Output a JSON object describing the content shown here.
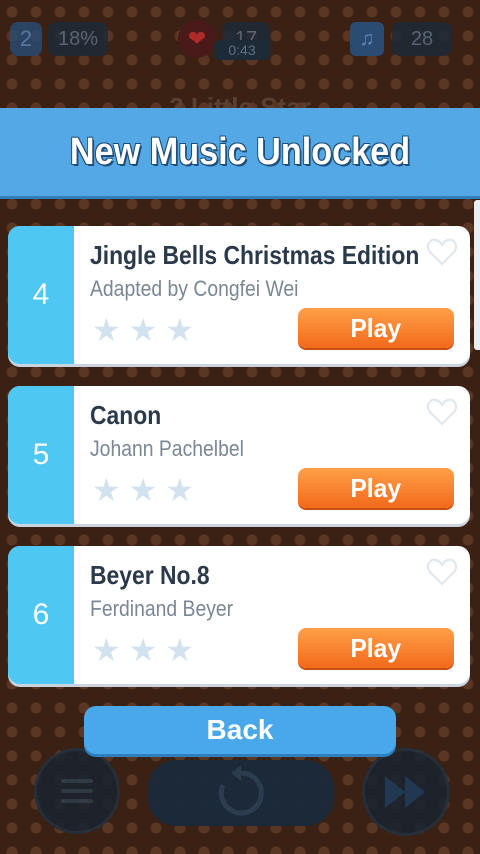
{
  "hud": {
    "level": "2",
    "percent": "18%",
    "lives": "17",
    "timer": "0:43",
    "notes": "28"
  },
  "background_title": "2 Little Star",
  "banner": {
    "title": "New Music Unlocked"
  },
  "songs": [
    {
      "number": "4",
      "title": "Jingle Bells Christmas Edition",
      "author": "Adapted by Congfei Wei",
      "play_label": "Play",
      "stars_earned": 0,
      "stars_total": 3
    },
    {
      "number": "5",
      "title": "Canon",
      "author": "Johann Pachelbel",
      "play_label": "Play",
      "stars_earned": 0,
      "stars_total": 3
    },
    {
      "number": "6",
      "title": "Beyer No.8",
      "author": "Ferdinand Beyer",
      "play_label": "Play",
      "stars_earned": 0,
      "stars_total": 3
    }
  ],
  "back_label": "Back",
  "icons": {
    "favorite": "heart-outline-icon",
    "star": "star-icon",
    "menu": "menu-icon",
    "replay": "replay-icon",
    "fast_forward": "fast-forward-icon"
  },
  "colors": {
    "banner": "#54a8e6",
    "number_panel": "#4ec8f2",
    "play_button": "#f26a1b",
    "back_button": "#49a8ea"
  }
}
